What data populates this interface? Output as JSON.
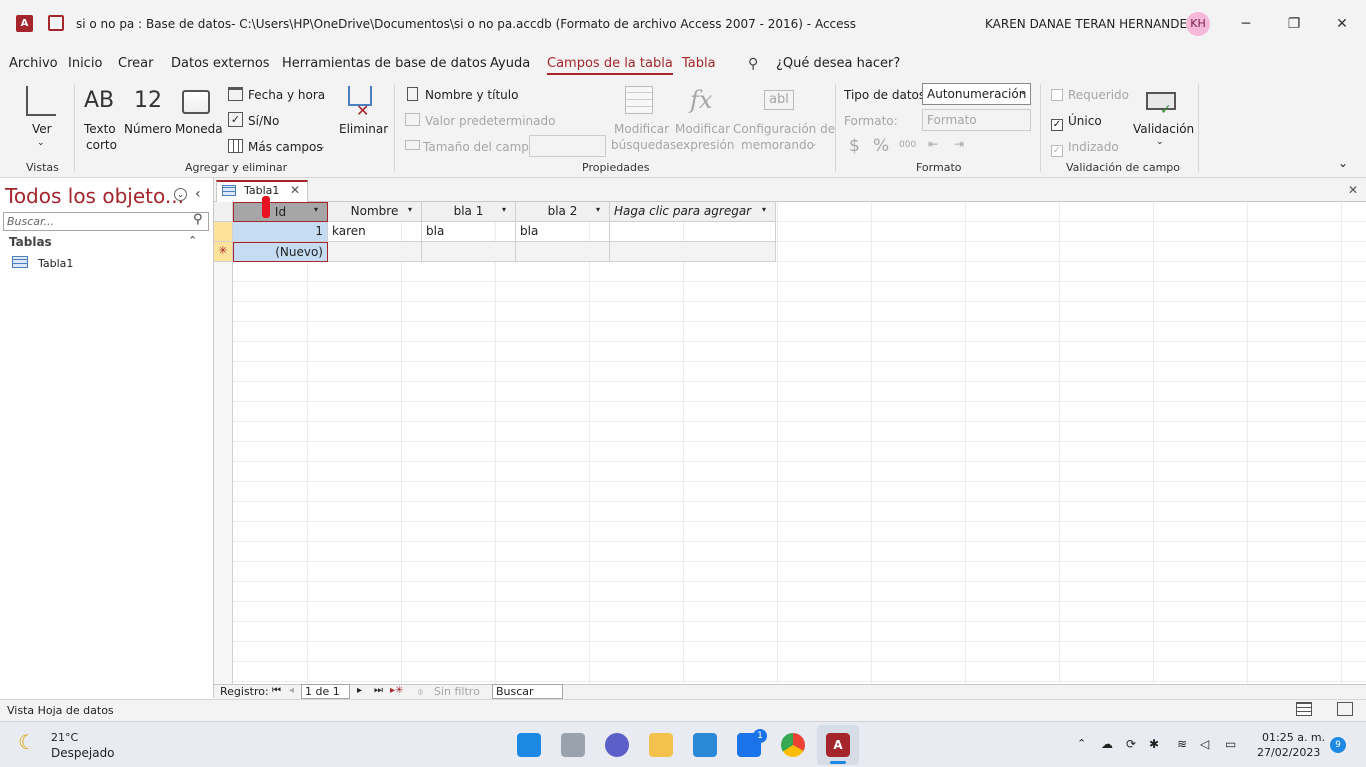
{
  "title_bar": {
    "title": "si o no pa : Base de datos- C:\\Users\\HP\\OneDrive\\Documentos\\si o no pa.accdb (Formato de archivo Access 2007 - 2016)  -  Access",
    "user_name": "KAREN DANAE TERAN HERNANDEZ",
    "user_initials": "KH",
    "minimize": "─",
    "restore": "❐",
    "close": "✕"
  },
  "menu": {
    "archivo": "Archivo",
    "inicio": "Inicio",
    "crear": "Crear",
    "datos_externos": "Datos externos",
    "herramientas": "Herramientas de base de datos",
    "ayuda": "Ayuda",
    "campos": "Campos de la tabla",
    "tabla": "Tabla",
    "search": "¿Qué desea hacer?"
  },
  "ribbon": {
    "vistas": {
      "ver": "Ver",
      "group": "Vistas"
    },
    "agregar": {
      "texto_big": "AB",
      "texto_1": "Texto",
      "texto_2": "corto",
      "numero_big": "12",
      "numero": "Número",
      "moneda": "Moneda",
      "fecha": "Fecha y hora",
      "sino": "Sí/No",
      "mas": "Más campos",
      "eliminar": "Eliminar",
      "group": "Agregar y eliminar"
    },
    "propiedades": {
      "nombre": "Nombre y título",
      "valor": "Valor predeterminado",
      "tamano": "Tamaño del campo",
      "mod_busq_1": "Modificar",
      "mod_busq_2": "búsquedas",
      "mod_expr_1": "Modificar",
      "mod_expr_2": "expresión",
      "config_1": "Configuración de",
      "config_2": "memorando",
      "group": "Propiedades"
    },
    "formato": {
      "tipo_label": "Tipo de datos:",
      "tipo_value": "Autonumeración",
      "formato_label": "Formato:",
      "formato_value": "Formato",
      "dollar": "$",
      "percent": "%",
      "thousands": "000",
      "group": "Formato"
    },
    "validacion": {
      "requerido": "Requerido",
      "unico": "Único",
      "indizado": "Indizado",
      "validacion": "Validación",
      "group": "Validación de campo"
    }
  },
  "nav_pane": {
    "title": "Todos los objeto...",
    "search_placeholder": "Buscar...",
    "section": "Tablas",
    "item": "Tabla1"
  },
  "doc_tab": {
    "label": "Tabla1"
  },
  "table": {
    "columns": [
      "Id",
      "Nombre",
      "bla 1",
      "bla 2",
      "Haga clic para agregar"
    ],
    "rows": [
      {
        "id": "1",
        "nombre": "karen",
        "bla1": "bla",
        "bla2": "bla"
      }
    ],
    "new_row": "(Nuevo)"
  },
  "record_nav": {
    "label": "Registro:",
    "position": "1 de 1",
    "filter": "Sin filtro",
    "search": "Buscar"
  },
  "status": {
    "text": "Vista Hoja de datos"
  },
  "taskbar": {
    "temp": "21°C",
    "weather": "Despejado",
    "time": "01:25 a. m.",
    "date": "27/02/2023",
    "mail_badge": "1",
    "notif_count": "9"
  },
  "colors": {
    "accent": "#a4262c",
    "selection": "#c5dcf3"
  }
}
